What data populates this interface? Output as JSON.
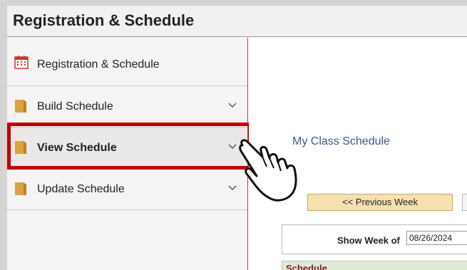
{
  "header": {
    "title": "Registration & Schedule"
  },
  "sidebar": {
    "items": [
      {
        "label": "Registration & Schedule",
        "icon": "calendar-icon"
      },
      {
        "label": "Build Schedule",
        "icon": "document-icon"
      },
      {
        "label": "View Schedule",
        "icon": "document-icon"
      },
      {
        "label": "Update Schedule",
        "icon": "document-icon"
      }
    ]
  },
  "main": {
    "schedule_link": "My Class Schedule",
    "previous_week_label": "<< Previous Week",
    "show_week_label": "Show Week of",
    "week_date_value": "08/26/2024",
    "schedule_header": "Schedule"
  },
  "colors": {
    "highlight": "#c00000",
    "icon": "#d9a441",
    "button": "#f5e1b0",
    "link": "#3a5a8a"
  }
}
